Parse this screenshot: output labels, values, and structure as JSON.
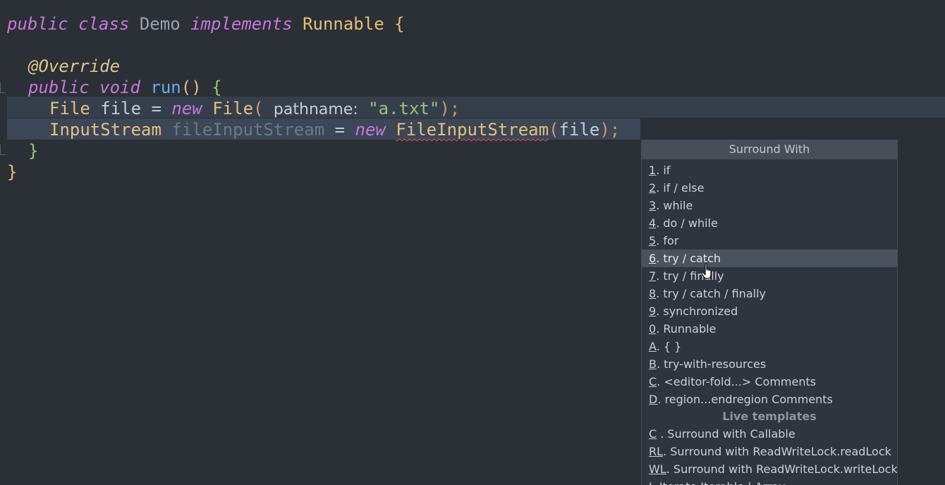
{
  "editor": {
    "line1": {
      "kw1": "public",
      "kw2": "class",
      "name": "Demo",
      "kw3": "implements",
      "iface": "Runnable",
      "brace": "{"
    },
    "line3": {
      "annotation": "@Override"
    },
    "line4": {
      "kw1": "public",
      "kw2": "void",
      "method": "run",
      "paren": "()",
      "brace": "{"
    },
    "line5": {
      "type": "File",
      "var": "file",
      "eq": "=",
      "kw": "new",
      "ctor": "File",
      "open": "(",
      "hint": "pathname:",
      "str": "\"a.txt\"",
      "close": ");"
    },
    "line6": {
      "type": "InputStream",
      "var": "fileInputStream",
      "eq": "=",
      "kw": "new",
      "ctor": "FileInputStream",
      "open": "(",
      "arg": "file",
      "close": ");"
    },
    "line7": {
      "brace": "}"
    },
    "line8": {
      "brace": "}"
    }
  },
  "popup": {
    "title": "Surround With",
    "items": [
      {
        "m": "1",
        "rest": ". if"
      },
      {
        "m": "2",
        "rest": ". if / else"
      },
      {
        "m": "3",
        "rest": ". while"
      },
      {
        "m": "4",
        "rest": ". do / while"
      },
      {
        "m": "5",
        "rest": ". for"
      },
      {
        "m": "6",
        "rest": ". try / catch"
      },
      {
        "m": "7",
        "rest": ". try / finally"
      },
      {
        "m": "8",
        "rest": ". try / catch / finally"
      },
      {
        "m": "9",
        "rest": ". synchronized"
      },
      {
        "m": "0",
        "rest": ". Runnable"
      },
      {
        "m": "A",
        "rest": ". { }"
      },
      {
        "m": "B",
        "rest": ". try-with-resources"
      },
      {
        "m": "C",
        "rest": ". <editor-fold...> Comments"
      },
      {
        "m": "D",
        "rest": ". region...endregion Comments"
      }
    ],
    "section": "Live templates",
    "templates": [
      {
        "m": "C",
        "rest": " . Surround with Callable"
      },
      {
        "m": "RL",
        "rest": ". Surround with ReadWriteLock.readLock"
      },
      {
        "m": "WL",
        "rest": ". Surround with ReadWriteLock.writeLock"
      },
      {
        "m": "I",
        "rest": ". Iterate Iterable | Array"
      }
    ],
    "selected_index": 5
  }
}
